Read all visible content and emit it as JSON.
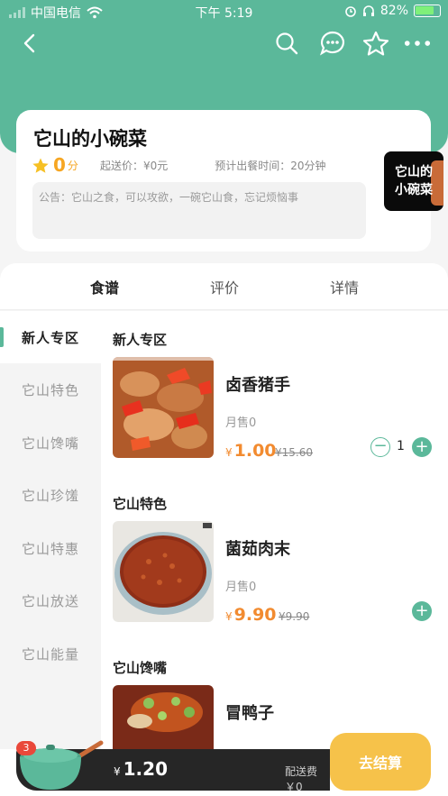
{
  "status_bar": {
    "carrier": "中国电信",
    "time": "下午 5:19",
    "battery": "82%"
  },
  "shop": {
    "name": "它山的小碗菜",
    "rating": "0",
    "rating_unit": "分",
    "min_delivery": "起送价：¥0元",
    "prep_time": "预计出餐时间：20分钟",
    "notice": "公告：它山之食，可以攻欲，一碗它山食，忘记烦恼事",
    "logo_text_1": "它山的",
    "logo_text_2": "小碗菜"
  },
  "tabs": [
    {
      "label": "食谱"
    },
    {
      "label": "评价"
    },
    {
      "label": "详情"
    }
  ],
  "categories": [
    {
      "label": "新人专区"
    },
    {
      "label": "它山特色"
    },
    {
      "label": "它山馋嘴"
    },
    {
      "label": "它山珍馐"
    },
    {
      "label": "它山特惠"
    },
    {
      "label": "它山放送"
    },
    {
      "label": "它山能量"
    }
  ],
  "sections": [
    {
      "title": "新人专区"
    },
    {
      "title": "它山特色"
    },
    {
      "title": "它山馋嘴"
    }
  ],
  "dishes": [
    {
      "name": "卤香猪手",
      "sales": "月售0",
      "currency": "¥",
      "price": "1.00",
      "old_price": "¥15.60",
      "qty": "1",
      "minus": "−",
      "plus": "+"
    },
    {
      "name": "菌茹肉末",
      "sales": "月售0",
      "currency": "¥",
      "price": "9.90",
      "old_price": "¥9.90",
      "plus": "+"
    },
    {
      "name": "冒鸭子"
    }
  ],
  "cart": {
    "count": "3",
    "currency": "¥",
    "total": "1.20",
    "delivery_fee": "配送费￥0",
    "checkout": "去结算"
  },
  "colors": {
    "brand": "#5bb89a",
    "price": "#f28b30",
    "checkout": "#f6c24a"
  }
}
